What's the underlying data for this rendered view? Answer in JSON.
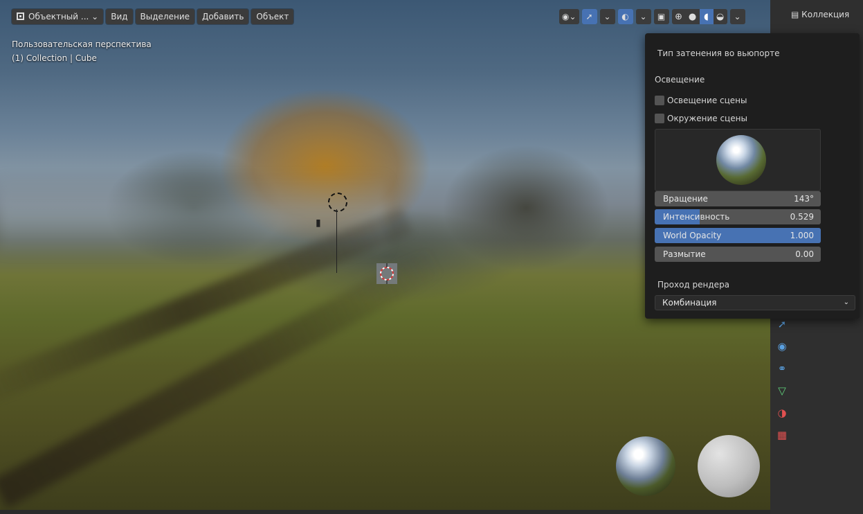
{
  "header": {
    "mode_label": "Объектный ...",
    "menus": [
      "Вид",
      "Выделение",
      "Добавить",
      "Объект"
    ]
  },
  "viewport": {
    "view_name": "Пользовательская перспектива",
    "object_info": "(1) Collection | Cube"
  },
  "outliner": {
    "title": "Коллекция"
  },
  "shading_popup": {
    "title": "Тип затенения во вьюпорте",
    "lighting_section": "Освещение",
    "checkbox_scene_lights": "Освещение сцены",
    "checkbox_scene_world": "Окружение сцены",
    "fields": {
      "rotation": {
        "label": "Вращение",
        "value": "143°"
      },
      "intensity": {
        "label": "Интенсивность",
        "value": "0.529",
        "fill_fraction": 0.27
      },
      "world_opacity": {
        "label": "World Opacity",
        "value": "1.000",
        "fill_fraction": 1.0
      },
      "blur": {
        "label": "Размытие",
        "value": "0.00"
      }
    },
    "render_pass_title": "Проход рендера",
    "render_pass_value": "Комбинация"
  },
  "colors": {
    "accent": "#4772b3",
    "popup_bg": "#1e1e1e",
    "field_bg": "#545454"
  },
  "icons": [
    "editor-type-icon",
    "gizmo-icon",
    "overlay-icon",
    "xray-icon",
    "wireframe-shading-icon",
    "solid-shading-icon",
    "material-shading-icon",
    "rendered-shading-icon",
    "gear-icon",
    "physics-tab-icon",
    "constraints-tab-icon",
    "data-tab-icon",
    "material-tab-icon",
    "texture-tab-icon"
  ]
}
